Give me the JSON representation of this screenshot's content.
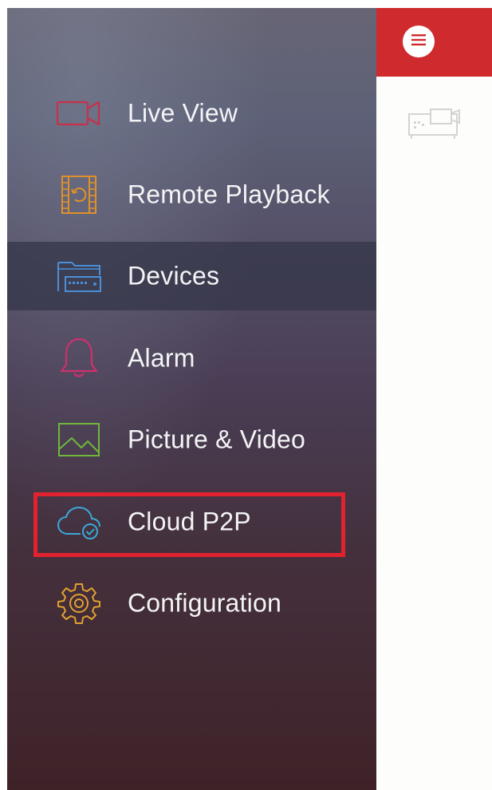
{
  "menu": {
    "items": [
      {
        "label": "Live View",
        "icon": "video-camera-icon"
      },
      {
        "label": "Remote Playback",
        "icon": "film-playback-icon"
      },
      {
        "label": "Devices",
        "icon": "device-folder-icon"
      },
      {
        "label": "Alarm",
        "icon": "bell-icon"
      },
      {
        "label": "Picture & Video",
        "icon": "picture-icon"
      },
      {
        "label": "Cloud P2P",
        "icon": "cloud-check-icon"
      },
      {
        "label": "Configuration",
        "icon": "gear-icon"
      }
    ],
    "active_item": "Devices",
    "highlighted_item": "Cloud P2P"
  },
  "header": {
    "menu_button_icon": "hamburger-menu-icon"
  },
  "colors": {
    "topbar": "#cf2a2e",
    "highlight": "#e2232f",
    "live_view_icon": "#c8304a",
    "playback_icon": "#e0902a",
    "devices_icon": "#4a8fd8",
    "alarm_icon": "#d0306e",
    "picture_icon": "#6fb83a",
    "cloud_icon": "#3aa8d8",
    "config_icon": "#e0a030"
  }
}
